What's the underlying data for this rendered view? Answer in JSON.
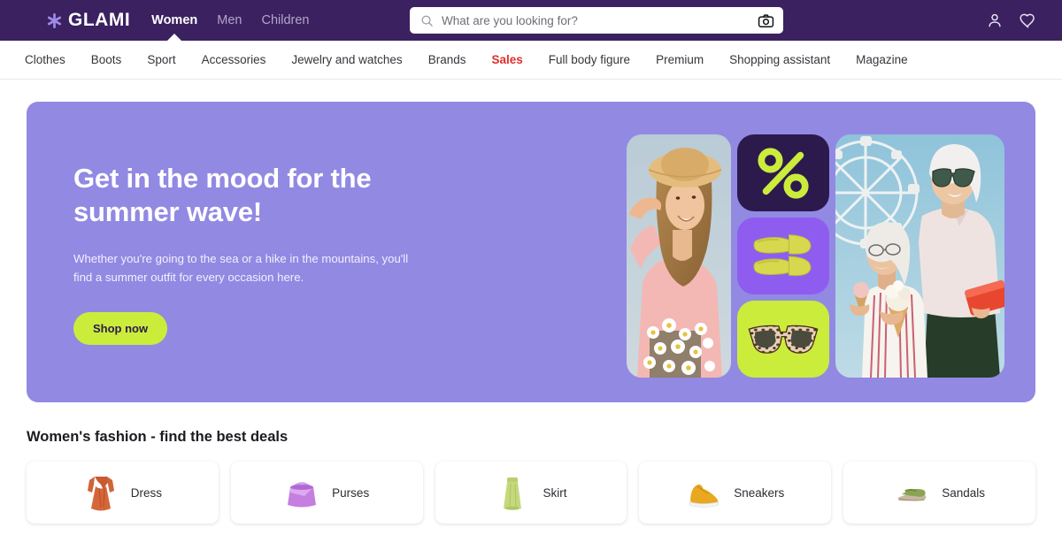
{
  "header": {
    "logo_text": "GLAMI",
    "logo_icon": "asterisk-icon",
    "gender_nav": [
      {
        "label": "Women",
        "active": true
      },
      {
        "label": "Men",
        "active": false
      },
      {
        "label": "Children",
        "active": false
      }
    ],
    "search": {
      "placeholder": "What are you looking for?",
      "value": "",
      "search_icon": "search-icon",
      "camera_icon": "camera-icon"
    },
    "actions": [
      {
        "icon": "user-icon",
        "name": "account"
      },
      {
        "icon": "heart-icon",
        "name": "favorites"
      }
    ],
    "colors": {
      "header_bg": "#3b2160",
      "accent": "#9289e3"
    }
  },
  "category_nav": [
    {
      "label": "Clothes",
      "highlight": false
    },
    {
      "label": "Boots",
      "highlight": false
    },
    {
      "label": "Sport",
      "highlight": false
    },
    {
      "label": "Accessories",
      "highlight": false
    },
    {
      "label": "Jewelry and watches",
      "highlight": false
    },
    {
      "label": "Brands",
      "highlight": false
    },
    {
      "label": "Sales",
      "highlight": true
    },
    {
      "label": "Full body figure",
      "highlight": false
    },
    {
      "label": "Premium",
      "highlight": false
    },
    {
      "label": "Shopping assistant",
      "highlight": false
    },
    {
      "label": "Magazine",
      "highlight": false
    }
  ],
  "hero": {
    "title_line1": "Get in the mood for the",
    "title_line2": "summer wave!",
    "subtitle": "Whether you're going to the sea or a hike in the mountains, you'll find a summer outfit for every occasion here.",
    "cta_label": "Shop now",
    "bg_color": "#9289e3",
    "cta_color": "#ccec3c",
    "collage": {
      "photo_left": "woman-straw-hat-daisies-photo",
      "photo_right": "two-women-ice-cream-ferris-wheel-photo",
      "tiles": [
        {
          "name": "percent-sale-tile",
          "icon": "percent-icon",
          "bg": "#2c1a4d",
          "fg": "#ccec3c"
        },
        {
          "name": "sandals-tile",
          "icon": "sandals-icon",
          "bg": "#8f5cf0",
          "fg": "#d9d84a"
        },
        {
          "name": "sunglasses-tile",
          "icon": "sunglasses-icon",
          "bg": "#ccec3c",
          "fg": "#3b3326"
        }
      ]
    }
  },
  "deals": {
    "title": "Women's fashion - find the best deals",
    "cards": [
      {
        "label": "Dress",
        "icon": "dress-icon"
      },
      {
        "label": "Purses",
        "icon": "purse-icon"
      },
      {
        "label": "Skirt",
        "icon": "skirt-icon"
      },
      {
        "label": "Sneakers",
        "icon": "sneaker-icon"
      },
      {
        "label": "Sandals",
        "icon": "sandal-icon"
      }
    ]
  }
}
